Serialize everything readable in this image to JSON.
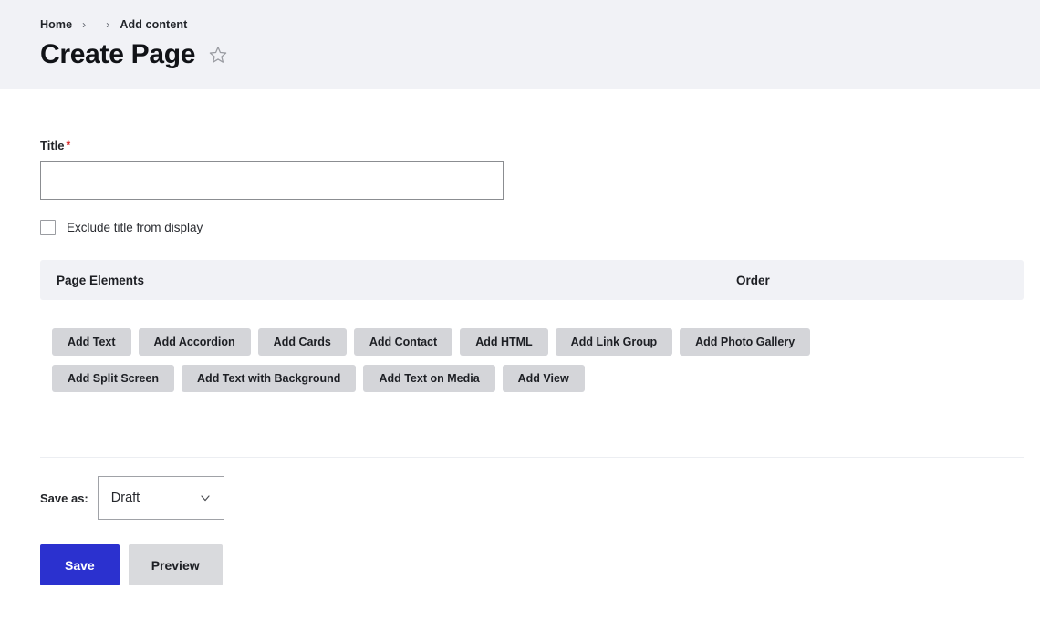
{
  "header": {
    "breadcrumb": [
      {
        "label": "Home"
      },
      {
        "label": ""
      },
      {
        "label": "Add content"
      }
    ],
    "breadcrumb_separator": "›",
    "title": "Create Page",
    "star_icon": "star-outline-icon"
  },
  "form": {
    "title_field": {
      "label": "Title",
      "required_marker": "*",
      "value": "",
      "placeholder": ""
    },
    "exclude_title_checkbox": {
      "label": "Exclude title from display",
      "checked": false
    }
  },
  "page_elements": {
    "columns": [
      {
        "label": "Page Elements"
      },
      {
        "label": "Order"
      }
    ],
    "add_buttons": [
      {
        "label": "Add Text"
      },
      {
        "label": "Add Accordion"
      },
      {
        "label": "Add Cards"
      },
      {
        "label": "Add Contact"
      },
      {
        "label": "Add HTML"
      },
      {
        "label": "Add Link Group"
      },
      {
        "label": "Add Photo Gallery"
      },
      {
        "label": "Add Split Screen"
      },
      {
        "label": "Add Text with Background"
      },
      {
        "label": "Add Text on Media"
      },
      {
        "label": "Add View"
      }
    ]
  },
  "footer": {
    "save_as_label": "Save as:",
    "save_as_value": "Draft",
    "save_as_options": [
      "Draft"
    ],
    "chevron_icon": "chevron-down-icon",
    "save_button": "Save",
    "preview_button": "Preview"
  },
  "colors": {
    "header_band": "#f1f2f6",
    "accent_primary": "#2b31cf",
    "button_gray": "#d4d5d9",
    "required_red": "#d72222",
    "text_primary": "#1b1b1d"
  }
}
